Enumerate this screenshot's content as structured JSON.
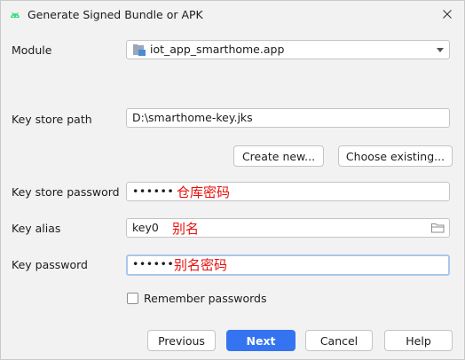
{
  "window": {
    "title": "Generate Signed Bundle or APK",
    "close_icon": "close-icon",
    "app_icon": "android-icon"
  },
  "form": {
    "module_label": "Module",
    "module_value": "iot_app_smarthome.app",
    "keystore_path_label": "Key store path",
    "keystore_path_value": "D:\\smarthome-key.jks",
    "create_new_label": "Create new...",
    "choose_existing_label": "Choose existing...",
    "keystore_password_label": "Key store password",
    "keystore_password_value": "••••••",
    "keystore_password_note": "仓库密码",
    "key_alias_label": "Key alias",
    "key_alias_value": "key0",
    "key_alias_note": "别名",
    "key_password_label": "Key password",
    "key_password_value": "••••••",
    "key_password_note": "别名密码",
    "remember_label": "Remember passwords",
    "remember_checked": false
  },
  "footer": {
    "previous_label": "Previous",
    "next_label": "Next",
    "cancel_label": "Cancel",
    "help_label": "Help"
  },
  "colors": {
    "accent": "#3574f0",
    "annotation": "#e8100e",
    "android_green": "#3ddc84",
    "focus_border": "#a9c8ea"
  }
}
